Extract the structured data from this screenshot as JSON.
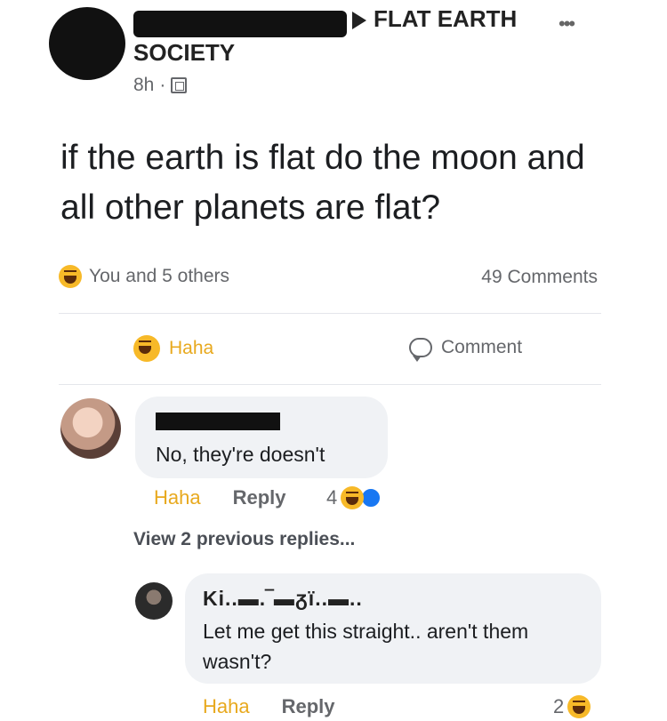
{
  "post": {
    "group_name": "FLAT EARTH",
    "group_name_line2": "SOCIETY",
    "more_icon": "more-horizontal-icon",
    "timestamp": "8h",
    "separator": "·",
    "privacy_icon": "group-icon",
    "text": "if the earth is flat do the moon and all other planets are flat?"
  },
  "reactions": {
    "summary": "You and 5 others",
    "comments_count": "49 Comments",
    "emoji": "haha-emoji-icon"
  },
  "actions": {
    "haha_label": "Haha",
    "comment_label": "Comment"
  },
  "comments": [
    {
      "text": "No, they're doesn't",
      "haha_label": "Haha",
      "reply_label": "Reply",
      "reaction_count": "4"
    },
    {
      "author_visible": "Ki..▬.‾▬ᵹï..▬..",
      "text": "Let me get this straight.. aren't them wasn't?",
      "haha_label": "Haha",
      "reply_label": "Reply",
      "reaction_count": "2"
    }
  ],
  "view_previous": "View 2 previous replies...",
  "colors": {
    "haha_accent": "#e8a91e",
    "muted_text": "#65676b",
    "bubble_bg": "#f0f2f5",
    "like_blue": "#1877f2"
  }
}
